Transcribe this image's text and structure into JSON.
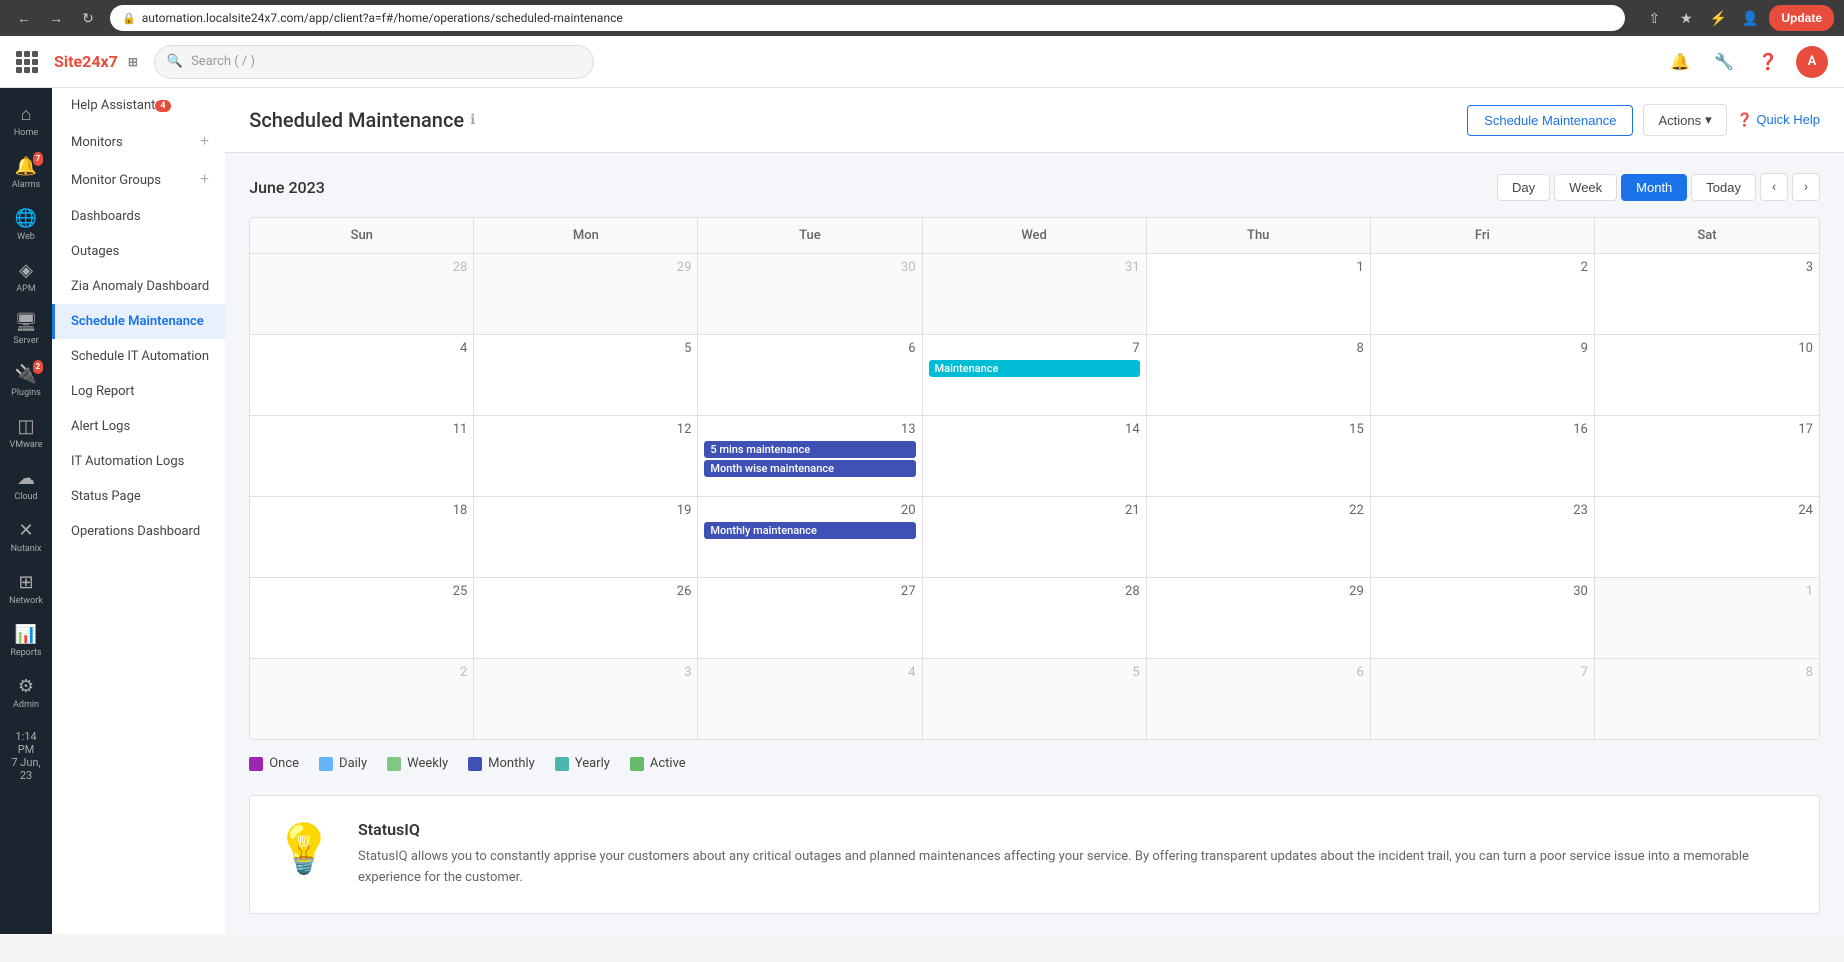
{
  "browser": {
    "url": "automation.localsite24x7.com/app/client?a=f#/home/operations/scheduled-maintenance",
    "back_label": "←",
    "forward_label": "→",
    "refresh_label": "↺",
    "update_label": "Update"
  },
  "header": {
    "logo": "Site24x7",
    "search_placeholder": "Search ( / )",
    "quick_help_label": "Quick Help"
  },
  "sidebar": {
    "nav_items": [
      {
        "id": "home",
        "icon": "⌂",
        "label": "Home",
        "active": false
      },
      {
        "id": "alarms",
        "icon": "🔔",
        "label": "Alarms",
        "badge": "7",
        "active": false
      },
      {
        "id": "web",
        "icon": "🌐",
        "label": "Web",
        "active": false
      },
      {
        "id": "apm",
        "icon": "⬡",
        "label": "APM",
        "active": false
      },
      {
        "id": "server",
        "icon": "🖥",
        "label": "Server",
        "active": false
      },
      {
        "id": "plugins",
        "icon": "🔌",
        "label": "Plugins",
        "badge": "2",
        "active": false
      },
      {
        "id": "vmware",
        "icon": "◫",
        "label": "VMware",
        "active": false
      },
      {
        "id": "cloud",
        "icon": "☁",
        "label": "Cloud",
        "active": false
      },
      {
        "id": "nutanix",
        "icon": "✕",
        "label": "Nutanix",
        "active": false
      },
      {
        "id": "network",
        "icon": "⊞",
        "label": "Network",
        "active": false
      },
      {
        "id": "reports",
        "icon": "📊",
        "label": "Reports",
        "active": false
      },
      {
        "id": "admin",
        "icon": "⚙",
        "label": "Admin",
        "active": false
      }
    ],
    "menu_items": [
      {
        "id": "help-assistant",
        "label": "Help Assistant",
        "badge": "4",
        "active": false
      },
      {
        "id": "monitors",
        "label": "Monitors",
        "has_add": true,
        "active": false
      },
      {
        "id": "monitor-groups",
        "label": "Monitor Groups",
        "has_add": true,
        "active": false
      },
      {
        "id": "dashboards",
        "label": "Dashboards",
        "active": false
      },
      {
        "id": "outages",
        "label": "Outages",
        "active": false
      },
      {
        "id": "zia-anomaly",
        "label": "Zia Anomaly Dashboard",
        "active": false
      },
      {
        "id": "schedule-maintenance",
        "label": "Schedule Maintenance",
        "active": true
      },
      {
        "id": "schedule-it-automation",
        "label": "Schedule IT Automation",
        "active": false
      },
      {
        "id": "log-report",
        "label": "Log Report",
        "active": false
      },
      {
        "id": "alert-logs",
        "label": "Alert Logs",
        "active": false
      },
      {
        "id": "it-automation-logs",
        "label": "IT Automation Logs",
        "active": false
      },
      {
        "id": "status-page",
        "label": "Status Page",
        "active": false
      },
      {
        "id": "operations-dashboard",
        "label": "Operations Dashboard",
        "active": false
      }
    ],
    "time_label": "1:14 PM",
    "date_label": "7 Jun, 23"
  },
  "page": {
    "title": "Scheduled Maintenance",
    "schedule_btn": "Schedule Maintenance",
    "actions_btn": "Actions",
    "quick_help_btn": "Quick Help"
  },
  "calendar": {
    "month_title": "June 2023",
    "view_day": "Day",
    "view_week": "Week",
    "view_month": "Month",
    "view_today": "Today",
    "day_headers": [
      "Sun",
      "Mon",
      "Tue",
      "Wed",
      "Thu",
      "Fri",
      "Sat"
    ],
    "weeks": [
      {
        "days": [
          {
            "date": "28",
            "other": true,
            "events": []
          },
          {
            "date": "29",
            "other": true,
            "events": []
          },
          {
            "date": "30",
            "other": true,
            "events": []
          },
          {
            "date": "31",
            "other": true,
            "events": []
          },
          {
            "date": "1",
            "other": false,
            "events": []
          },
          {
            "date": "2",
            "other": false,
            "events": []
          },
          {
            "date": "3",
            "other": false,
            "events": []
          }
        ]
      },
      {
        "days": [
          {
            "date": "4",
            "other": false,
            "events": []
          },
          {
            "date": "5",
            "other": false,
            "events": []
          },
          {
            "date": "6",
            "other": false,
            "events": []
          },
          {
            "date": "7",
            "other": false,
            "events": [
              {
                "label": "Maintenance",
                "type": "maintenance"
              }
            ]
          },
          {
            "date": "8",
            "other": false,
            "events": []
          },
          {
            "date": "9",
            "other": false,
            "events": []
          },
          {
            "date": "10",
            "other": false,
            "events": []
          }
        ]
      },
      {
        "days": [
          {
            "date": "11",
            "other": false,
            "events": []
          },
          {
            "date": "12",
            "other": false,
            "events": []
          },
          {
            "date": "13",
            "other": false,
            "events": [
              {
                "label": "5 mins maintenance",
                "type": "5mins"
              },
              {
                "label": "Month wise maintenance",
                "type": "monthwise"
              }
            ]
          },
          {
            "date": "14",
            "other": false,
            "events": []
          },
          {
            "date": "15",
            "other": false,
            "events": []
          },
          {
            "date": "16",
            "other": false,
            "events": []
          },
          {
            "date": "17",
            "other": false,
            "events": []
          }
        ]
      },
      {
        "days": [
          {
            "date": "18",
            "other": false,
            "events": []
          },
          {
            "date": "19",
            "other": false,
            "events": []
          },
          {
            "date": "20",
            "other": false,
            "events": [
              {
                "label": "Monthly maintenance",
                "type": "monthly"
              }
            ]
          },
          {
            "date": "21",
            "other": false,
            "events": []
          },
          {
            "date": "22",
            "other": false,
            "events": []
          },
          {
            "date": "23",
            "other": false,
            "events": []
          },
          {
            "date": "24",
            "other": false,
            "events": []
          }
        ]
      },
      {
        "days": [
          {
            "date": "25",
            "other": false,
            "events": []
          },
          {
            "date": "26",
            "other": false,
            "events": []
          },
          {
            "date": "27",
            "other": false,
            "events": []
          },
          {
            "date": "28",
            "other": false,
            "events": []
          },
          {
            "date": "29",
            "other": false,
            "events": []
          },
          {
            "date": "30",
            "other": false,
            "events": []
          },
          {
            "date": "1",
            "other": true,
            "events": []
          }
        ]
      },
      {
        "days": [
          {
            "date": "2",
            "other": true,
            "events": []
          },
          {
            "date": "3",
            "other": true,
            "events": []
          },
          {
            "date": "4",
            "other": true,
            "events": []
          },
          {
            "date": "5",
            "other": true,
            "events": []
          },
          {
            "date": "6",
            "other": true,
            "events": []
          },
          {
            "date": "7",
            "other": true,
            "events": []
          },
          {
            "date": "8",
            "other": true,
            "events": []
          }
        ]
      }
    ],
    "legend": [
      {
        "id": "once",
        "label": "Once",
        "color": "#9c27b0"
      },
      {
        "id": "daily",
        "label": "Daily",
        "color": "#64b5f6"
      },
      {
        "id": "weekly",
        "label": "Weekly",
        "color": "#81c784"
      },
      {
        "id": "monthly",
        "label": "Monthly",
        "color": "#3f51b5"
      },
      {
        "id": "yearly",
        "label": "Yearly",
        "color": "#4db6ac"
      },
      {
        "id": "active",
        "label": "Active",
        "color": "#66bb6a"
      }
    ]
  },
  "statusiq": {
    "title": "StatusIQ",
    "description": "StatusIQ allows you to constantly apprise your customers about any critical outages and planned maintenances affecting your service. By offering transparent updates about the incident trail, you can turn a poor service issue into a memorable experience for the customer."
  }
}
